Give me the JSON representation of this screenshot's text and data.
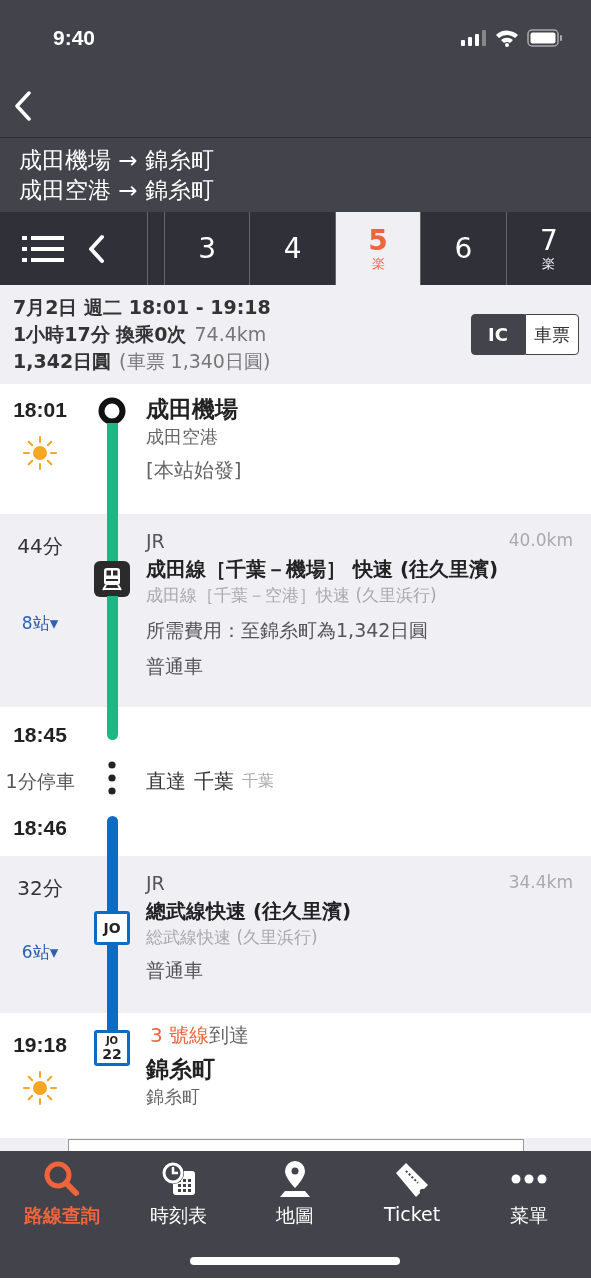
{
  "status_bar": {
    "time": "9:40"
  },
  "route": {
    "lines": [
      "成田機場 → 錦糸町",
      "成田空港 → 錦糸町"
    ]
  },
  "route_tabs": [
    {
      "label": "3",
      "selected": false
    },
    {
      "label": "4",
      "selected": false
    },
    {
      "label": "5",
      "badge": "楽",
      "selected": true
    },
    {
      "label": "6",
      "selected": false
    },
    {
      "label": "7",
      "badge": "楽",
      "selected": false
    }
  ],
  "summary": {
    "date_time": "7月2日 週二 18:01 - 19:18",
    "duration": "1小時17分 換乘0次",
    "distance": "74.4km",
    "fare": "1,342日圓",
    "ticket_fare": "(車票 1,340日圓)",
    "fare_toggle": [
      {
        "label": "IC",
        "selected": true
      },
      {
        "label": "車票",
        "selected": false
      }
    ]
  },
  "timeline": [
    {
      "kind": "station",
      "time": "18:01",
      "name": "成田機場",
      "name_local": "成田空港",
      "note": "[本站始發]",
      "marker": {
        "kind": "origin"
      }
    },
    {
      "kind": "segment",
      "duration": "44分",
      "stations": "8站▾",
      "operator": "JR",
      "distance": "40.0km",
      "line": "成田線［千葉－機場］ 快速 (往久里濱)",
      "line_local": "成田線［千葉－空港］快速 (久里浜行)",
      "fare_note": "所需費用：至錦糸町為1,342日圓",
      "car": "普通車",
      "color": "#1db784",
      "marker": {
        "kind": "train"
      }
    },
    {
      "kind": "stop",
      "arrive": "18:45",
      "stop": "1分停車",
      "depart": "18:46",
      "label": "直達",
      "name": "千葉",
      "name_local": "千葉"
    },
    {
      "kind": "segment",
      "duration": "32分",
      "stations": "6站▾",
      "operator": "JR",
      "distance": "34.4km",
      "line": "總武線快速 (往久里濱)",
      "line_local": "総武線快速 (久里浜行)",
      "car": "普通車",
      "color": "#0b6cc6",
      "marker": {
        "kind": "code",
        "code": "JO"
      }
    },
    {
      "kind": "station",
      "time": "19:18",
      "platform": "3 號線",
      "platform_suffix": "到達",
      "name": "錦糸町",
      "name_local": "錦糸町",
      "marker": {
        "kind": "code",
        "code": "JO",
        "number": "22"
      }
    }
  ],
  "tab_bar": [
    {
      "label": "路線查詢",
      "selected": true
    },
    {
      "label": "時刻表",
      "selected": false
    },
    {
      "label": "地圖",
      "selected": false
    },
    {
      "label": "Ticket",
      "selected": false
    },
    {
      "label": "菜單",
      "selected": false
    }
  ]
}
